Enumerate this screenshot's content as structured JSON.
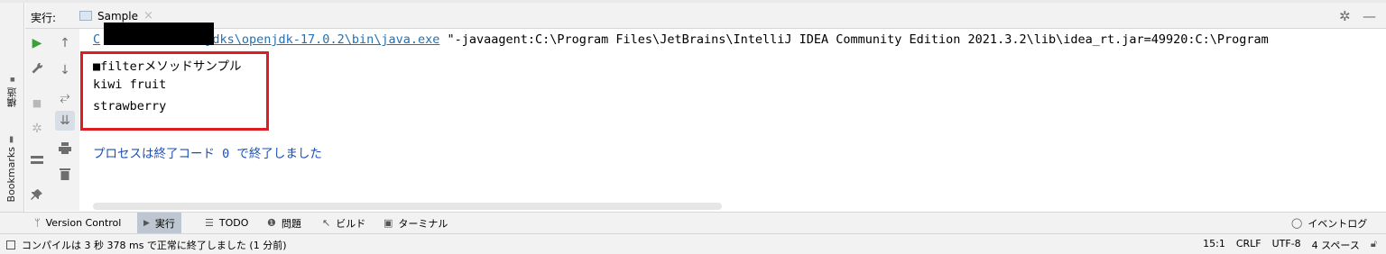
{
  "left_rail": {
    "structure_label": "構造",
    "bookmarks_label": "Bookmarks"
  },
  "run_panel": {
    "title": "実行:",
    "tab_label": "Sample",
    "tab_close": "×",
    "settings_icon": "gear-icon",
    "minimize_icon": "minimize-icon"
  },
  "toolbar": {
    "buttons": [
      "run-icon",
      "up-arrow-icon",
      "wrench-icon",
      "down-arrow-icon",
      "stop-icon",
      "soft-wrap-icon",
      "scroll-to-end-icon",
      "debug-icon",
      "print-icon",
      "layout-icon",
      "trash-icon",
      "pin-icon"
    ]
  },
  "console": {
    "cmd_prefix": "C",
    "cmd_path": ".jdks\\openjdk-17.0.2\\bin\\java.exe",
    "cmd_args": " \"-javaagent:C:\\Program Files\\JetBrains\\IntelliJ IDEA Community Edition 2021.3.2\\lib\\idea_rt.jar=49920:C:\\Program",
    "output": [
      "■filterメソッドサンプル",
      "kiwi fruit",
      "strawberry"
    ],
    "exit_message": "プロセスは終了コード 0 で終了しました"
  },
  "bottom_tabs": [
    {
      "label": "Version Control",
      "icon": "branch-icon"
    },
    {
      "label": "実行",
      "icon": "play-icon"
    },
    {
      "label": "TODO",
      "icon": "list-icon"
    },
    {
      "label": "問題",
      "icon": "warning-icon"
    },
    {
      "label": "ビルド",
      "icon": "hammer-icon"
    },
    {
      "label": "ターミナル",
      "icon": "terminal-icon"
    }
  ],
  "event_log": "イベントログ",
  "status": {
    "message": "コンパイルは 3 秒 378 ms で正常に終了しました (1 分前)",
    "position": "15:1",
    "line_sep": "CRLF",
    "encoding": "UTF-8",
    "indent": "4 スペース"
  },
  "colors": {
    "highlight_border": "#e01b24",
    "link": "#2470b3",
    "exit_message": "#1d4fb3",
    "run_green": "#3d9e3d"
  }
}
